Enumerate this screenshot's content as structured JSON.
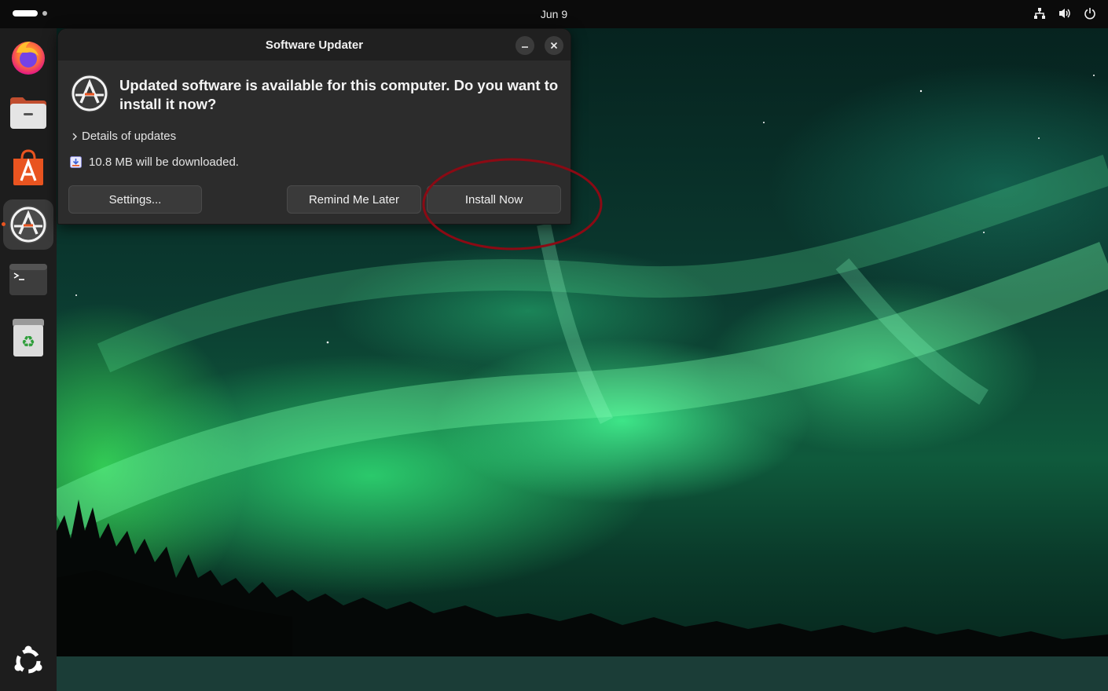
{
  "top_bar": {
    "date": "Jun 9",
    "tray_icons": [
      "network-icon",
      "volume-icon",
      "power-icon"
    ]
  },
  "dock": {
    "items": [
      {
        "name": "firefox",
        "icon": "firefox-icon",
        "running": false
      },
      {
        "name": "files",
        "icon": "files-icon",
        "running": false
      },
      {
        "name": "app-center",
        "icon": "app-center-icon",
        "running": false
      },
      {
        "name": "software-updater",
        "icon": "software-updater-icon",
        "running": true,
        "active": true
      },
      {
        "name": "terminal",
        "icon": "terminal-icon",
        "running": false
      },
      {
        "name": "trash",
        "icon": "trash-icon",
        "running": false
      }
    ],
    "show_apps_icon": "ubuntu-logo-icon"
  },
  "dialog": {
    "title": "Software Updater",
    "headline": "Updated software is available for this computer. Do you want to install it now?",
    "details_label": "Details of updates",
    "download_text": "10.8 MB will be downloaded.",
    "buttons": {
      "settings": "Settings...",
      "remind": "Remind Me Later",
      "install": "Install Now"
    }
  },
  "colors": {
    "accent": "#e95420",
    "annotation_ring": "#8b0a14",
    "dialog_bg": "#2c2c2c",
    "titlebar_bg": "#202020"
  }
}
